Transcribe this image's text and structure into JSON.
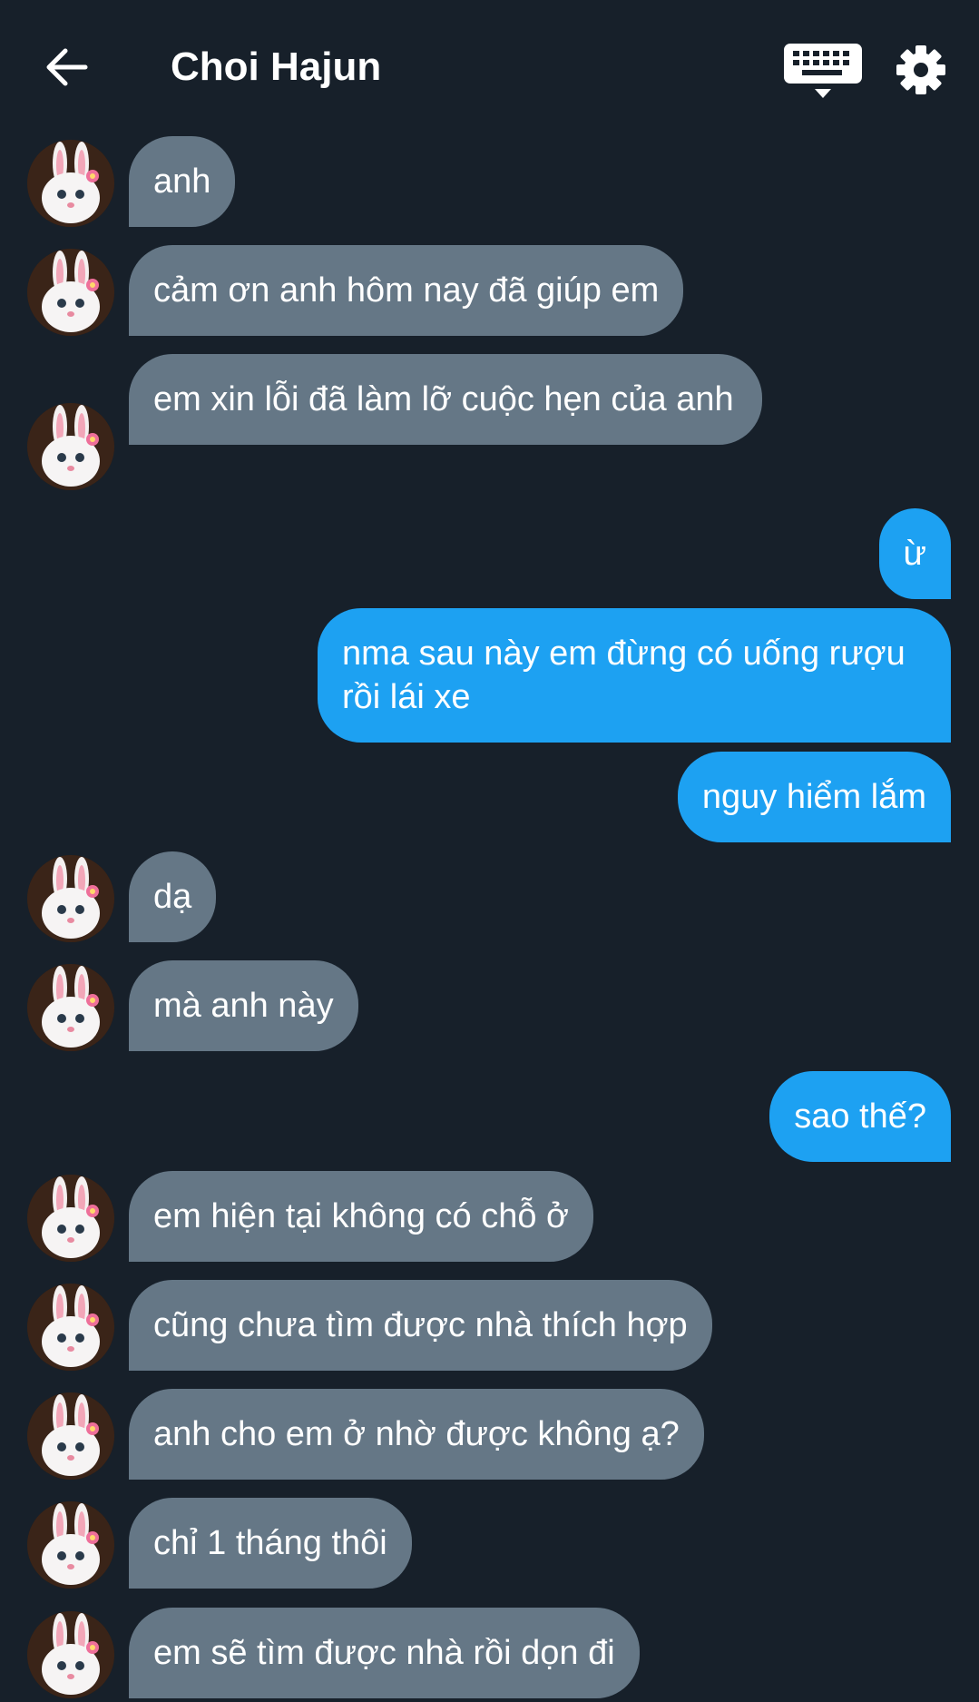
{
  "header": {
    "title": "Choi Hajun",
    "back_icon": "arrow-left-icon",
    "keyboard_icon": "keyboard-icon",
    "settings_icon": "gear-icon"
  },
  "colors": {
    "background": "#17202a",
    "incoming_bubble": "#657786",
    "outgoing_bubble": "#1da1f2",
    "text": "#ffffff"
  },
  "messages": [
    {
      "direction": "in",
      "text": "anh",
      "avatar": "bunny-avatar"
    },
    {
      "direction": "in",
      "text": "cảm ơn anh hôm nay đã giúp em",
      "avatar": "bunny-avatar"
    },
    {
      "direction": "in",
      "text": "em xin lỗi đã làm lỡ cuộc hẹn của anh",
      "avatar": "bunny-avatar"
    },
    {
      "direction": "out",
      "text": "ừ"
    },
    {
      "direction": "out",
      "text": "nma sau này em đừng có uống rượu rồi lái xe"
    },
    {
      "direction": "out",
      "text": "nguy hiểm lắm"
    },
    {
      "direction": "in",
      "text": "dạ",
      "avatar": "bunny-avatar"
    },
    {
      "direction": "in",
      "text": "mà anh này",
      "avatar": "bunny-avatar"
    },
    {
      "direction": "out",
      "text": "sao thế?"
    },
    {
      "direction": "in",
      "text": "em hiện tại không có chỗ ở",
      "avatar": "bunny-avatar"
    },
    {
      "direction": "in",
      "text": "cũng chưa tìm được nhà thích hợp",
      "avatar": "bunny-avatar"
    },
    {
      "direction": "in",
      "text": "anh cho em ở nhờ được không ạ?",
      "avatar": "bunny-avatar"
    },
    {
      "direction": "in",
      "text": "chỉ 1 tháng thôi",
      "avatar": "bunny-avatar"
    },
    {
      "direction": "in",
      "text": "em sẽ tìm được nhà rồi dọn đi",
      "avatar": "bunny-avatar"
    }
  ]
}
